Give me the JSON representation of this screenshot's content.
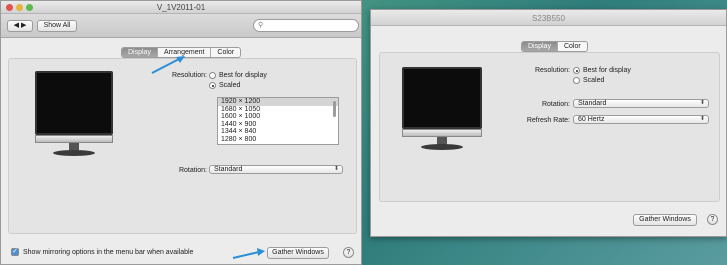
{
  "window_left": {
    "title": "V_1V2011-01",
    "show_all": "Show All",
    "search_placeholder": "",
    "tabs": [
      {
        "label": "Display",
        "selected": true
      },
      {
        "label": "Arrangement",
        "selected": false
      },
      {
        "label": "Color",
        "selected": false
      }
    ],
    "resolution_label": "Resolution:",
    "resolution_options": [
      {
        "label": "Best for display",
        "selected": false
      },
      {
        "label": "Scaled",
        "selected": true
      }
    ],
    "resolutions": [
      "1920 × 1200",
      "1680 × 1050",
      "1600 × 1000",
      "1440 × 900",
      "1344 × 840",
      "1280 × 800"
    ],
    "selected_resolution": "1920 × 1200",
    "rotation_label": "Rotation:",
    "rotation_value": "Standard",
    "mirroring_label": "Show mirroring options in the menu bar when available",
    "mirroring_checked": true,
    "gather_windows": "Gather Windows",
    "help": "?"
  },
  "window_right": {
    "title": "S23B550",
    "tabs": [
      {
        "label": "Display",
        "selected": true
      },
      {
        "label": "Color",
        "selected": false
      }
    ],
    "resolution_label": "Resolution:",
    "resolution_options": [
      {
        "label": "Best for display",
        "selected": true
      },
      {
        "label": "Scaled",
        "selected": false
      }
    ],
    "rotation_label": "Rotation:",
    "rotation_value": "Standard",
    "refresh_label": "Refresh Rate:",
    "refresh_value": "60 Hertz",
    "gather_windows": "Gather Windows",
    "help": "?"
  },
  "colors": {
    "arrow": "#2b8fd6",
    "close": "#e0524c",
    "minimize": "#e6b43a",
    "zoom": "#59b94a",
    "selected_tab": "#8c8c8c"
  }
}
